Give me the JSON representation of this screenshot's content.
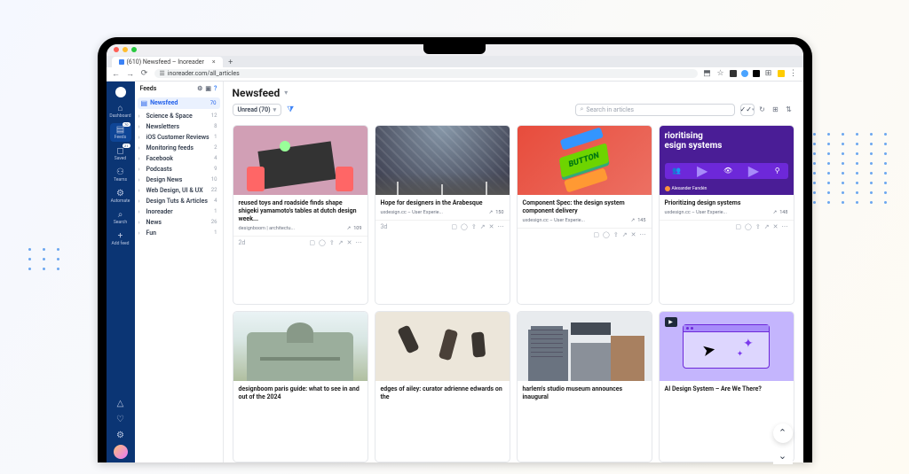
{
  "browser": {
    "tab_title": "(610) Newsfeed – Inoreader",
    "url": "inoreader.com/all_articles"
  },
  "nav_rail": {
    "dashboard": "Dashboard",
    "feeds": "Feeds",
    "feeds_badge": "70",
    "saved": "Saved",
    "saved_badge": "21",
    "teams": "Teams",
    "automate": "Automate",
    "search": "Search",
    "add_feed": "Add feed"
  },
  "sidebar": {
    "header": "Feeds",
    "newsfeed_label": "Newsfeed",
    "newsfeed_count": "70",
    "items": [
      {
        "name": "Science & Space",
        "count": "12"
      },
      {
        "name": "Newsletters",
        "count": "8"
      },
      {
        "name": "iOS Customer Reviews",
        "count": "1"
      },
      {
        "name": "Monitoring feeds",
        "count": "2"
      },
      {
        "name": "Facebook",
        "count": "4"
      },
      {
        "name": "Podcasts",
        "count": "9"
      },
      {
        "name": "Design News",
        "count": "10"
      },
      {
        "name": "Web Design, UI & UX",
        "count": "22"
      },
      {
        "name": "Design Tuts & Articles",
        "count": "4"
      },
      {
        "name": "Inoreader",
        "count": "1"
      },
      {
        "name": "News",
        "count": "26"
      },
      {
        "name": "Fun",
        "count": "1"
      }
    ]
  },
  "main": {
    "title": "Newsfeed",
    "filter_btn": "Unread (70)",
    "search_placeholder": "Search in articles"
  },
  "cards": [
    {
      "title": "reused toys and roadside finds shape shigeki yamamoto's tables at dutch design week...",
      "source": "designboom | architectu...",
      "stat": "109",
      "age": "2d",
      "img_type": "toys"
    },
    {
      "title": "Hope for designers in the Arabesque",
      "source": "uxdesign.cc – User Experie...",
      "stat": "150",
      "age": "3d",
      "img_type": "arabesque"
    },
    {
      "title": "Component Spec: the design system component delivery",
      "source": "uxdesign.cc – User Experie...",
      "stat": "145",
      "age": "",
      "img_type": "button"
    },
    {
      "title": "Prioritizing design systems",
      "source": "uxdesign.cc – User Experie...",
      "stat": "148",
      "age": "",
      "img_type": "priority"
    },
    {
      "title": "designboom paris guide: what to see in and out of the 2024",
      "source": "",
      "stat": "",
      "age": "",
      "img_type": "paris"
    },
    {
      "title": "edges of ailey: curator adrienne edwards on the",
      "source": "",
      "stat": "",
      "age": "",
      "img_type": "ailey"
    },
    {
      "title": "harlem's studio museum announces inaugural",
      "source": "",
      "stat": "",
      "age": "",
      "img_type": "harlem"
    },
    {
      "title": "AI Design System – Are We There?",
      "source": "",
      "stat": "",
      "age": "",
      "img_type": "ai"
    }
  ],
  "chart_texts": {
    "button_label": "BUTTON",
    "priority_line1": "rioritising",
    "priority_line2": "esign systems",
    "priority_author": "Alexander Fandén"
  }
}
